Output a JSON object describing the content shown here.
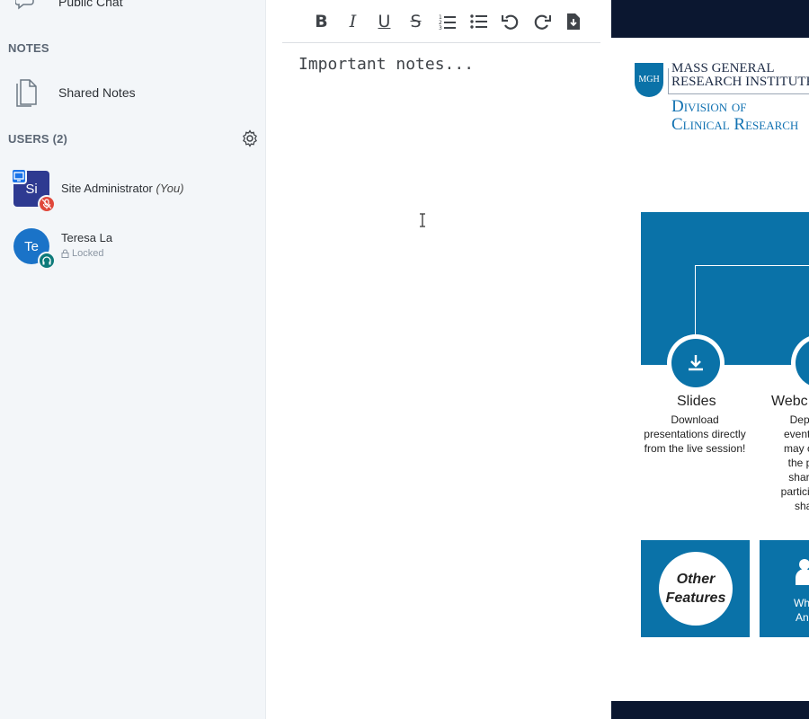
{
  "sidebar": {
    "public_chat_label": "Public Chat",
    "notes_section": "NOTES",
    "shared_notes_label": "Shared Notes",
    "users_section": "USERS (2)",
    "users": [
      {
        "initials": "Si",
        "name": "Site Administrator",
        "suffix": "(You)",
        "color": "#2e3a91",
        "shape": "square"
      },
      {
        "initials": "Te",
        "name": "Teresa La",
        "status": "Locked",
        "color": "#1a73c8",
        "shape": "round"
      }
    ]
  },
  "notes": {
    "toolbar": {
      "bold": "B",
      "italic": "I",
      "underline": "U",
      "strike": "S"
    },
    "placeholder": "Important notes..."
  },
  "presentation": {
    "org_line1": "MASS GENERAL",
    "org_line2": "RESEARCH INSTITUTE",
    "shield_text": "MGH",
    "division_line1": "Division of",
    "division_line2": "Clinical Research",
    "features": [
      {
        "title": "Slides",
        "desc": [
          "Download",
          "presentations directly",
          "from the live session!"
        ]
      },
      {
        "title": "Webc",
        "desc": [
          "Depen",
          "event, y",
          "may onl",
          "the pre",
          "shared",
          "participa",
          "share"
        ]
      }
    ],
    "tile_other_line1": "Other",
    "tile_other_line2": "Features",
    "tile_partial": [
      "Wh",
      "An"
    ]
  },
  "colors": {
    "accent_blue": "#0a72a8",
    "sidebar_bg": "#f3f6f9",
    "admin_badge": "#e0473a",
    "listen_badge": "#0d7a7a"
  }
}
